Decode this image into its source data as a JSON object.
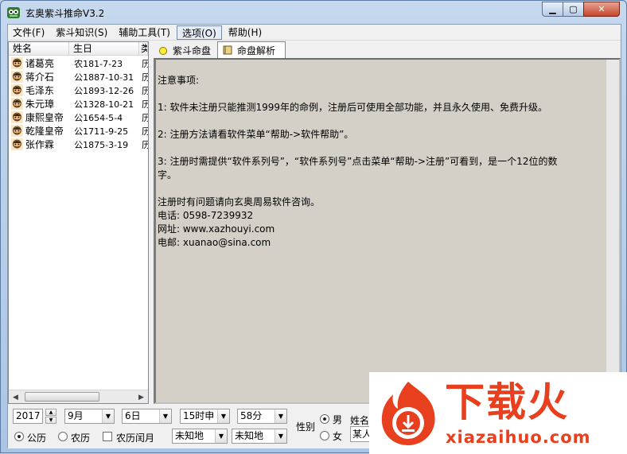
{
  "window": {
    "title": "玄奥紫斗推命V3.2"
  },
  "menu": [
    {
      "label": "文件(F)"
    },
    {
      "label": "紫斗知识(S)"
    },
    {
      "label": "辅助工具(T)"
    },
    {
      "label": "选项(O)"
    },
    {
      "label": "帮助(H)"
    }
  ],
  "list": {
    "headers": [
      "姓名",
      "生日",
      "类"
    ],
    "rows": [
      {
        "name": "诸葛亮",
        "birth": "农181-7-23",
        "extra": "历"
      },
      {
        "name": "蒋介石",
        "birth": "公1887-10-31",
        "extra": "历"
      },
      {
        "name": "毛泽东",
        "birth": "公1893-12-26",
        "extra": "历"
      },
      {
        "name": "朱元璋",
        "birth": "公1328-10-21",
        "extra": "历"
      },
      {
        "name": "康熙皇帝",
        "birth": "公1654-5-4",
        "extra": "历"
      },
      {
        "name": "乾隆皇帝",
        "birth": "公1711-9-25",
        "extra": "历"
      },
      {
        "name": "张作霖",
        "birth": "公1875-3-19",
        "extra": "历"
      }
    ]
  },
  "tabs": [
    {
      "label": "紫斗命盘"
    },
    {
      "label": "命盘解析"
    }
  ],
  "notice": {
    "heading": "注意事项:",
    "p1": "1: 软件未注册只能推测1999年的命例，注册后可使用全部功能，并且永久使用、免费升级。",
    "p2": "2: 注册方法请看软件菜单“帮助->软件帮助”。",
    "p3a": "3: 注册时需提供“软件系列号”，“软件系列号”点击菜单“帮助->注册”可看到，是一个12位的数",
    "p3b": "字。",
    "contact_intro": "注册时有问题请向玄奥周易软件咨询。",
    "phone": "电话: 0598-7239932",
    "site": "网址: www.xazhouyi.com",
    "email": "电邮: xuanao@sina.com"
  },
  "controls": {
    "year": "2017",
    "month": "9月",
    "day": "6日",
    "hour": "15时申",
    "minute": "58分",
    "calendar_solar": "公历",
    "calendar_lunar": "农历",
    "leap_month": "农历闰月",
    "place1": "未知地",
    "place2": "未知地",
    "gender_label": "性别",
    "male": "男",
    "female": "女",
    "name_label": "姓名",
    "name_value": "某人"
  },
  "watermark": {
    "title": "下载火",
    "url": "xiazaihuo.com"
  },
  "colors": {
    "accent": "#e8401e",
    "panel_bg": "#d4d0c8"
  }
}
